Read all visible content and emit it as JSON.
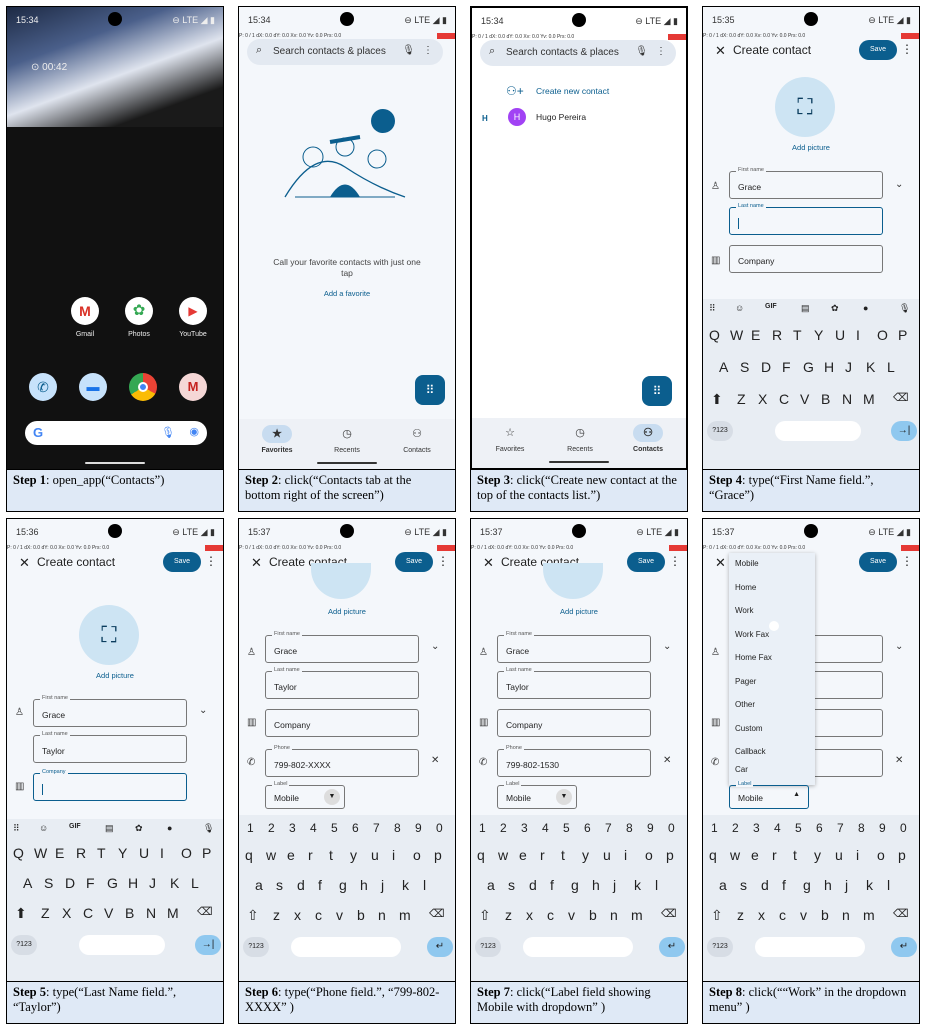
{
  "status": {
    "time1": "15:34",
    "time2": "15:35",
    "time3": "15:36",
    "time4": "15:37",
    "right": "⊖ LTE ◢ ▮",
    "debug": "P: 0 / 1   dX: 0.0   dY: 0.0   Xv: 0.0   Yv: 0.0   Prs: 0.0"
  },
  "lock": {
    "clock": "⊙ 00:42"
  },
  "home": {
    "apps": [
      "Gmail",
      "Photos",
      "YouTube"
    ]
  },
  "contacts": {
    "search_placeholder": "Search contacts & places",
    "call_text": "Call your favorite contacts with just one tap",
    "add_favorite": "Add a favorite",
    "create_new": "Create new contact",
    "section_letter": "H",
    "contact_initial": "H",
    "contact_name": "Hugo Pereira",
    "nav": [
      "Favorites",
      "Recents",
      "Contacts"
    ]
  },
  "create": {
    "title": "Create contact",
    "save": "Save",
    "add_picture": "Add picture",
    "first_name_label": "First name",
    "last_name_label": "Last name",
    "company": "Company",
    "phone_label": "Phone",
    "label_label": "Label",
    "first_name": "Grace",
    "last_name": "Taylor",
    "phone_xxxx": "799-802-XXXX",
    "phone_full": "799-802-1530",
    "label_value": "Mobile"
  },
  "keyboard": {
    "top": [
      "GIF"
    ],
    "qwerty_upper": [
      "Q",
      "W",
      "E",
      "R",
      "T",
      "Y",
      "U",
      "I",
      "O",
      "P"
    ],
    "asdf_upper": [
      "A",
      "S",
      "D",
      "F",
      "G",
      "H",
      "J",
      "K",
      "L"
    ],
    "zxcv_upper": [
      "Z",
      "X",
      "C",
      "V",
      "B",
      "N",
      "M"
    ],
    "numbers": [
      "1",
      "2",
      "3",
      "4",
      "5",
      "6",
      "7",
      "8",
      "9",
      "0"
    ],
    "qwerty_lower": [
      "q",
      "w",
      "e",
      "r",
      "t",
      "y",
      "u",
      "i",
      "o",
      "p"
    ],
    "asdf_lower": [
      "a",
      "s",
      "d",
      "f",
      "g",
      "h",
      "j",
      "k",
      "l"
    ],
    "zxcv_lower": [
      "z",
      "x",
      "c",
      "v",
      "b",
      "n",
      "m"
    ],
    "sym": "?123"
  },
  "menu": {
    "items": [
      "Mobile",
      "Home",
      "Work",
      "Work Fax",
      "Home Fax",
      "Pager",
      "Other",
      "Custom",
      "Callback",
      "Car"
    ]
  },
  "steps": [
    {
      "n": "Step 1",
      "a": ": open_app(“Contacts”)"
    },
    {
      "n": "Step 2",
      "a": ": click(“Contacts tab at the bottom right of the screen”)"
    },
    {
      "n": "Step 3",
      "a": ": click(“Create new contact at the top of the contacts list.”)"
    },
    {
      "n": "Step 4",
      "a": ": type(“First Name field.”, “Grace”)"
    },
    {
      "n": "Step 5",
      "a": ": type(“Last Name field.”, “Taylor”)"
    },
    {
      "n": "Step 6",
      "a": ": type(“Phone field.”, “799-802-XXXX” )"
    },
    {
      "n": "Step 7",
      "a": ": click(“Label field showing Mobile with dropdown” )"
    },
    {
      "n": "Step 8",
      "a": ": click(““Work” in the dropdown menu” )"
    }
  ]
}
